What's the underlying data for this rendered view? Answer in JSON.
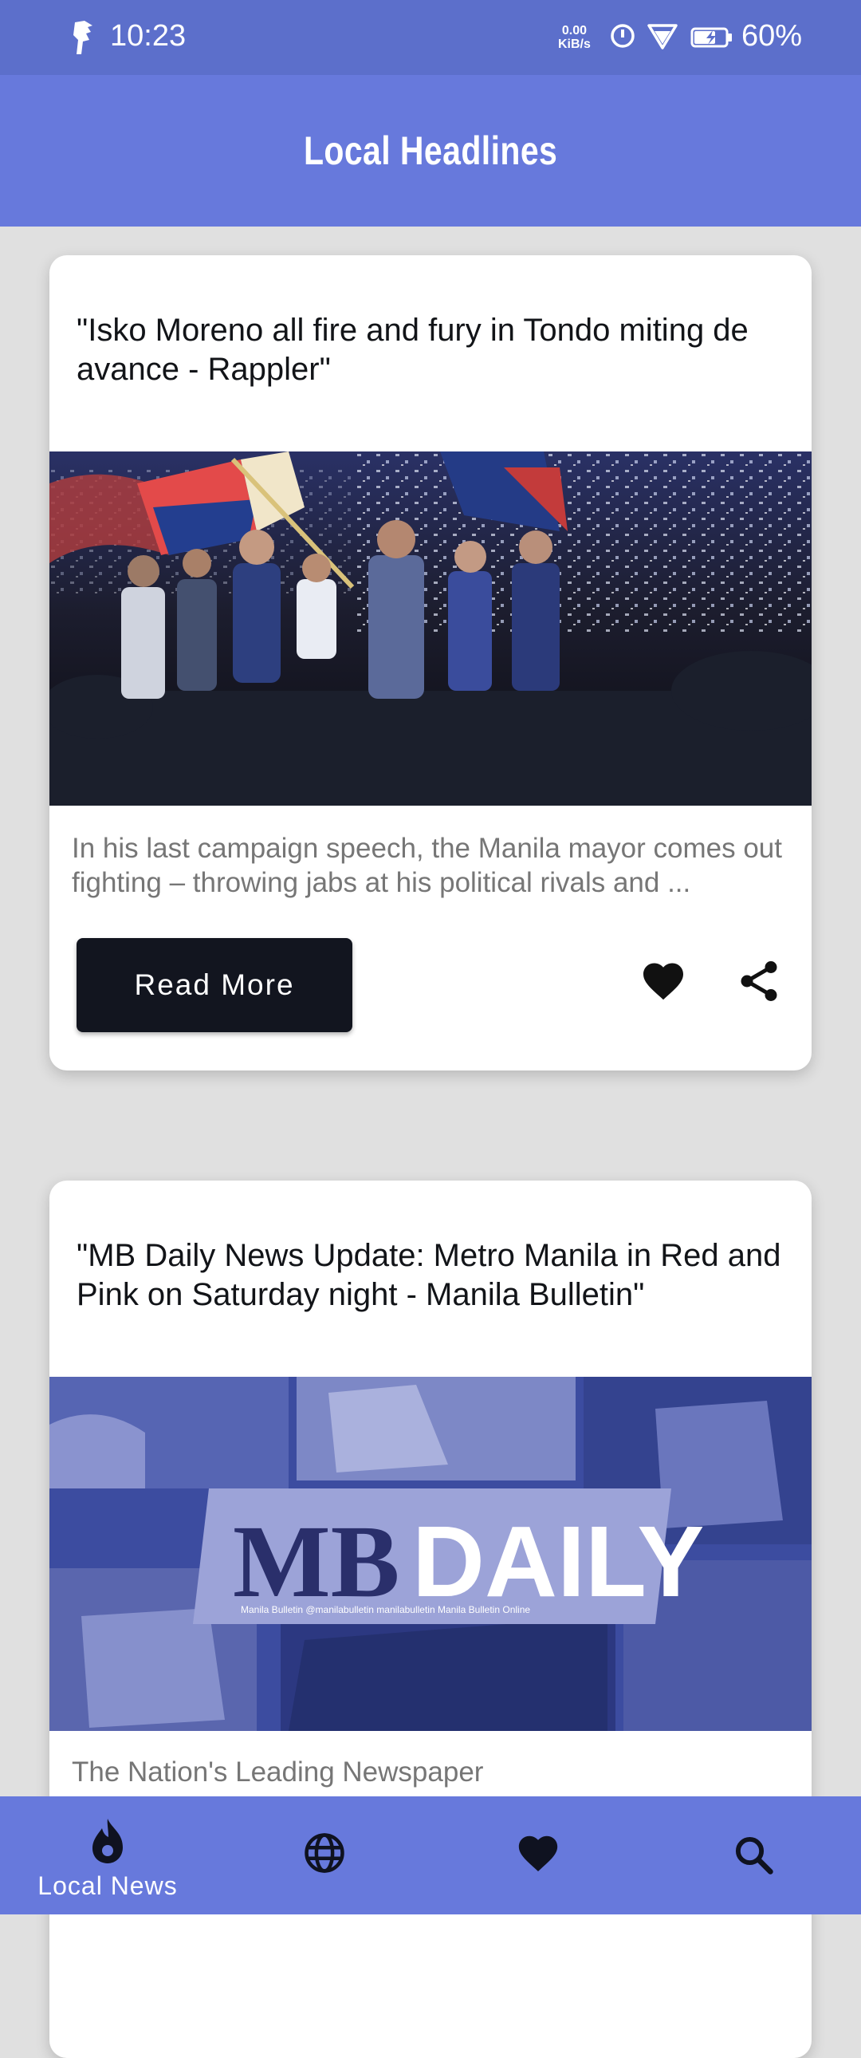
{
  "status_bar": {
    "time": "10:23",
    "net_speed_value": "0.00",
    "net_speed_unit": "KiB/s",
    "battery_percent": "60%",
    "icons": [
      "app-logo-icon",
      "data-saver-icon",
      "wifi-icon",
      "battery-charging-icon"
    ]
  },
  "app_bar": {
    "title": "Local Headlines"
  },
  "articles": [
    {
      "title": "\"Isko Moreno all fire and fury in Tondo miting de avance - Rappler\"",
      "description": "In his last campaign speech, the Manila mayor comes out fighting – throwing jabs at his political rivals and ...",
      "read_more_label": "Read More",
      "image": "rally-photo-with-confetti-and-flag"
    },
    {
      "title": "\"MB Daily News Update: Metro Manila in Red and Pink on Saturday night - Manila Bulletin\"",
      "description": "The Nation's Leading Newspaper",
      "image_text_mb": "MB",
      "image_text_daily": "DAILY",
      "image_socials": "Manila Bulletin  @manilabulletin  manilabulletin  Manila Bulletin Online",
      "image": "mb-daily-collage"
    }
  ],
  "bottom_nav": {
    "items": [
      {
        "icon": "flame-icon",
        "label": "Local News",
        "active": true
      },
      {
        "icon": "globe-icon",
        "label": ""
      },
      {
        "icon": "heart-icon",
        "label": ""
      },
      {
        "icon": "search-icon",
        "label": ""
      }
    ]
  },
  "colors": {
    "status_bar": "#5c6fcb",
    "app_bar": "#6779dc",
    "background": "#e0e0e0",
    "button": "#12151f"
  }
}
